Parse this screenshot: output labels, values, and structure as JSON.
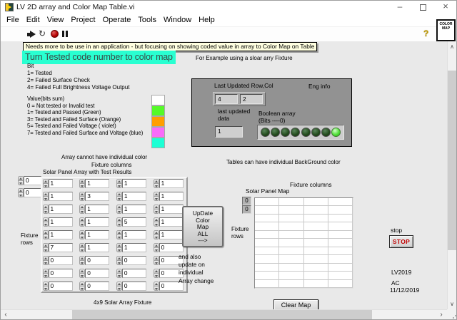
{
  "window": {
    "title": "LV 2D array and Color Map Table.vi"
  },
  "menu": {
    "items": [
      "File",
      "Edit",
      "View",
      "Project",
      "Operate",
      "Tools",
      "Window",
      "Help"
    ]
  },
  "toolbar": {
    "help": "?",
    "vi_icon": "COLOR\nMAP"
  },
  "notes": {
    "tooltip": "Needs more to be use in an application - but focusing on showing coded value in array to Color Map on Table",
    "headline": "Turn Tested code number to color map",
    "example": "For Example using a sloar arry Fixture",
    "array_note": "Array cannot have individual color",
    "table_note": "Tables can have individual BackGround color",
    "update_note": "and also\nupdate on\nindividual\nArray change"
  },
  "bit_legend": [
    "Bit",
    "1= Tested",
    "2= Failed Surface Check",
    "4= Failed Full Brightness Voltage Output"
  ],
  "value_legend": {
    "title": "Value(bits sum)",
    "entries": [
      {
        "label": "0 = Not tested or Invalid test",
        "color": "#FFFFFF"
      },
      {
        "label": "1= Tested and Passed (Green)",
        "color": "#55FA28"
      },
      {
        "label": "3= Tested and Failed Surface (Orange)",
        "color": "#FF9E00"
      },
      {
        "label": "5= Tested and Failed Voltage ( violet)",
        "color": "#F96BF9"
      },
      {
        "label": "7= Tested and Failed Surface and Voltage (blue)",
        "color": "#1CFFD4"
      }
    ]
  },
  "eng_panel": {
    "row_col_label": "Last Updated Row,Col",
    "row": "4",
    "col": "2",
    "eng_info": "Eng info",
    "last_updated": "last updated\ndata",
    "last_value": "1",
    "bool_label": "Boolean array\n(Bits ----0)",
    "leds": [
      0,
      0,
      0,
      0,
      0,
      0,
      0,
      1
    ]
  },
  "solar_array": {
    "title": "Solar Panel Array with Test Results",
    "columns_label": "Fixture columns",
    "rows_label": "Fixture\nrows",
    "index": [
      "0",
      "0"
    ],
    "values": [
      [
        "1",
        "1",
        "1",
        "1"
      ],
      [
        "1",
        "3",
        "1",
        "1"
      ],
      [
        "1",
        "1",
        "1",
        "1"
      ],
      [
        "1",
        "1",
        "5",
        "1"
      ],
      [
        "1",
        "1",
        "1",
        "1"
      ],
      [
        "7",
        "1",
        "1",
        "0"
      ],
      [
        "0",
        "0",
        "0",
        "0"
      ],
      [
        "0",
        "0",
        "0",
        "0"
      ],
      [
        "0",
        "0",
        "0",
        "0"
      ]
    ],
    "caption": "4x9 Solar Array Fixture"
  },
  "update_button": {
    "label": "UpDate\nColor\nMap\nALL\n--->"
  },
  "map_table": {
    "title": "Solar Panel Map",
    "columns_label": "Fixture columns",
    "rows_label": "Fixture\nrows",
    "index": [
      "0",
      "0"
    ],
    "rows": 11,
    "cols": 4
  },
  "stop": {
    "label": "stop",
    "button": "STOP"
  },
  "footer": {
    "clear": "Clear Map",
    "lv": "LV2019",
    "initials": "AC",
    "date": "11/12/2019"
  }
}
